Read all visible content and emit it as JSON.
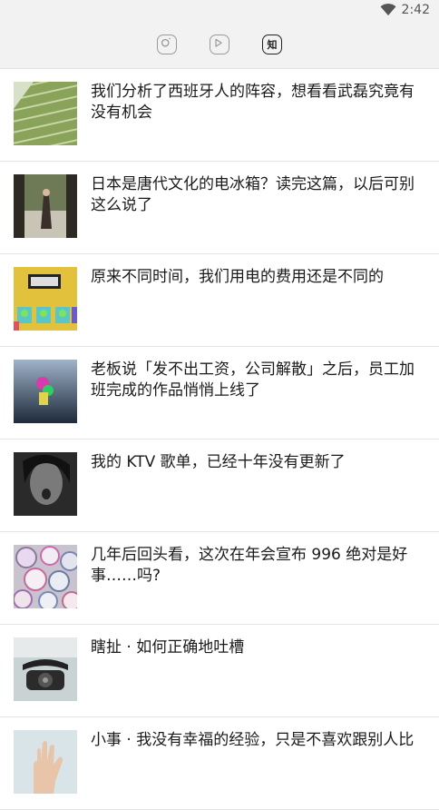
{
  "status_bar": {
    "time": "2:42",
    "wifi_icon": "wifi-icon"
  },
  "tabs": [
    {
      "name": "tab-instagram",
      "icon": "instagram-icon"
    },
    {
      "name": "tab-video",
      "icon": "play-icon"
    },
    {
      "name": "tab-zhihu",
      "icon": "zhihu-icon",
      "label": "知",
      "active": true
    }
  ],
  "articles": [
    {
      "title": "我们分析了西班牙人的阵容，想看看武磊究竟有没有机会",
      "thumb": "stadium-seats-image"
    },
    {
      "title": "日本是唐代文化的电冰箱？读完这篇，以后可别这么说了",
      "thumb": "woman-in-corridor-image"
    },
    {
      "title": "原来不同时间，我们用电的费用还是不同的",
      "thumb": "electric-meter-image"
    },
    {
      "title": "老板说「发不出工资，公司解散」之后，员工加班完成的作品悄悄上线了",
      "thumb": "toy-figure-image"
    },
    {
      "title": "我的 KTV 歌单，已经十年没有更新了",
      "thumb": "singer-face-image"
    },
    {
      "title": "几年后回头看，这次在年会宣布 996 绝对是好事……吗?",
      "thumb": "clocks-image"
    },
    {
      "title": "瞎扯 · 如何正确地吐槽",
      "thumb": "rotary-phone-image"
    },
    {
      "title": "小事 · 我没有幸福的经验，只是不喜欢跟别人比",
      "thumb": "hand-image"
    }
  ]
}
